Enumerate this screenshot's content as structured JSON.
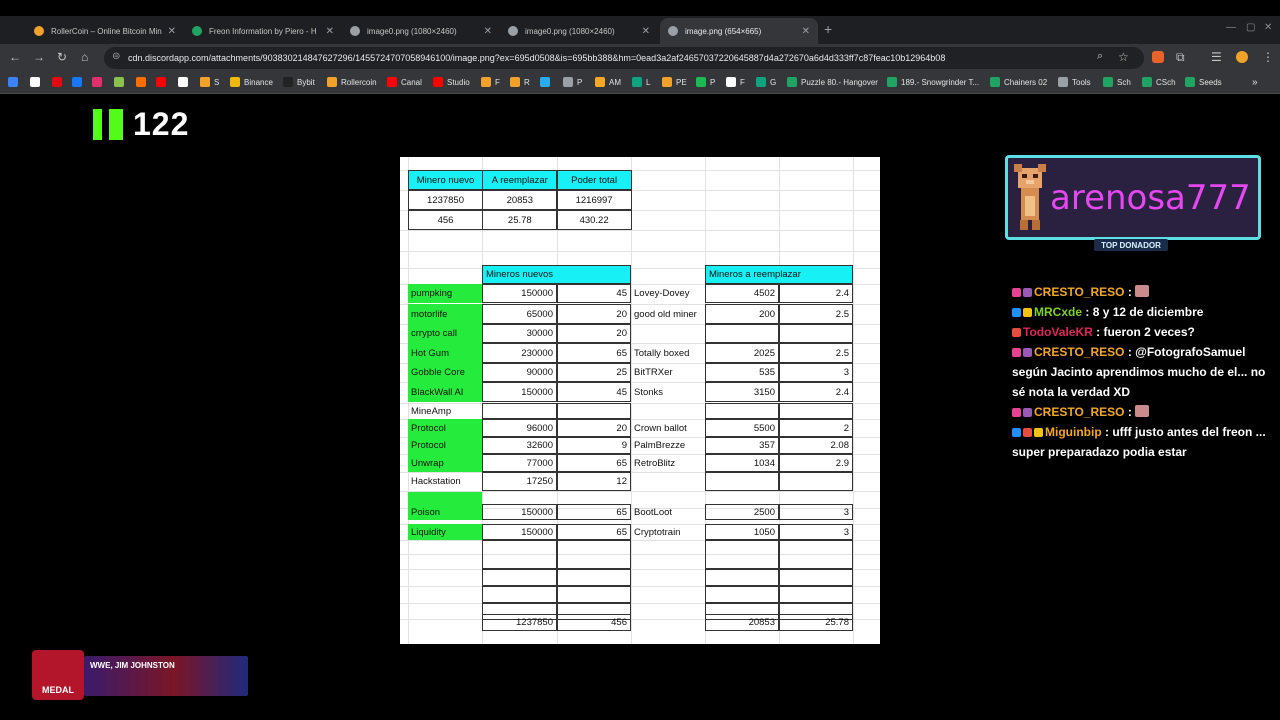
{
  "browser": {
    "tabs": [
      {
        "title": "RollerCoin – Online Bitcoin Min",
        "favicon": "rollercoin-icon",
        "color": "#f2a22a",
        "active": false
      },
      {
        "title": "Freon Information by Piero - H",
        "favicon": "sheets-icon",
        "color": "#1fa463",
        "active": false
      },
      {
        "title": "image0.png (1080×2460)",
        "favicon": "globe-icon",
        "color": "#9aa0a6",
        "active": false
      },
      {
        "title": "image0.png (1080×2460)",
        "favicon": "globe-icon",
        "color": "#9aa0a6",
        "active": false
      },
      {
        "title": "image.png (654×665)",
        "favicon": "globe-icon",
        "color": "#9aa0a6",
        "active": true
      }
    ],
    "url": "cdn.discordapp.com/attachments/903830214847627296/1455724707058946100/image.png?ex=695d0508&is=695bb388&hm=0ead3a2af24657037220645887d4a272670a6d4d333ff7c87feac10b12964b08",
    "bookmarks": [
      {
        "label": "",
        "color": "#3b82f6"
      },
      {
        "label": "",
        "color": "#ffffff"
      },
      {
        "label": "",
        "color": "#e50914"
      },
      {
        "label": "",
        "color": "#1877f2"
      },
      {
        "label": "",
        "color": "#e1306c"
      },
      {
        "label": "",
        "color": "#8bc34a"
      },
      {
        "label": "",
        "color": "#ff6f00"
      },
      {
        "label": "",
        "color": "#ff0000"
      },
      {
        "label": "",
        "color": "#ffffff"
      },
      {
        "label": "",
        "color": "#ffcc00"
      },
      {
        "label": "S",
        "color": "#f2a22a"
      },
      {
        "label": "Binance",
        "color": "#f0b90b"
      },
      {
        "label": "Bybit",
        "color": "#222222"
      },
      {
        "label": "Rollercoin",
        "color": "#f2a22a"
      },
      {
        "label": "Canal",
        "color": "#ff0000"
      },
      {
        "label": "Studio",
        "color": "#ff0000"
      },
      {
        "label": "F",
        "color": "#f2a22a"
      },
      {
        "label": "R",
        "color": "#f2a22a"
      },
      {
        "label": "",
        "color": "#2aabee"
      },
      {
        "label": "P",
        "color": "#9aa0a6"
      },
      {
        "label": "AM",
        "color": "#f9a825"
      },
      {
        "label": "L",
        "color": "#10a37f"
      },
      {
        "label": "PE",
        "color": "#f2a22a"
      },
      {
        "label": "P",
        "color": "#1db954"
      },
      {
        "label": "F",
        "color": "#ffffff"
      },
      {
        "label": "G",
        "color": "#10a37f"
      },
      {
        "label": "Puzzle 80.- Hangover",
        "color": "#1fa463"
      },
      {
        "label": "189.- Snowgrinder T...",
        "color": "#1fa463"
      },
      {
        "label": "Chainers 02",
        "color": "#1fa463"
      },
      {
        "label": "Tools",
        "color": "#9aa0a6"
      },
      {
        "label": "Sch",
        "color": "#1fa463"
      },
      {
        "label": "CSch",
        "color": "#1fa463"
      },
      {
        "label": "Seeds",
        "color": "#1fa463"
      }
    ]
  },
  "kick": {
    "count": "122",
    "accent": "#53fc18"
  },
  "sheet": {
    "summary_headers": [
      "Minero nuevo",
      "A reemplazar",
      "Poder total"
    ],
    "summary_rows": [
      [
        "1237850",
        "20853",
        "1216997"
      ],
      [
        "456",
        "25.78",
        "430.22"
      ]
    ],
    "new_header": "Mineros nuevos",
    "replace_header": "Mineros a reemplazar",
    "rows": [
      {
        "new_name": "pumpking",
        "new_power": "150000",
        "new_bonus": "45",
        "rep_name": "Lovey-Dovey",
        "rep_power": "4502",
        "rep_bonus": "2.4"
      },
      {
        "new_name": "motorlife",
        "new_power": "65000",
        "new_bonus": "20",
        "rep_name": "good old miner",
        "rep_power": "200",
        "rep_bonus": "2.5"
      },
      {
        "new_name": "crrypto call",
        "new_power": "30000",
        "new_bonus": "20",
        "rep_name": "",
        "rep_power": "",
        "rep_bonus": ""
      },
      {
        "new_name": "Hot Gum",
        "new_power": "230000",
        "new_bonus": "65",
        "rep_name": "Totally boxed",
        "rep_power": "2025",
        "rep_bonus": "2.5"
      },
      {
        "new_name": "Gobble Core",
        "new_power": "90000",
        "new_bonus": "25",
        "rep_name": "BitTRXer",
        "rep_power": "535",
        "rep_bonus": "3"
      },
      {
        "new_name": "BlackWall AI",
        "new_power": "150000",
        "new_bonus": "45",
        "rep_name": "Stonks",
        "rep_power": "3150",
        "rep_bonus": "2.4"
      },
      {
        "new_name": "MineAmp",
        "new_power": "",
        "new_bonus": "",
        "rep_name": "",
        "rep_power": "",
        "rep_bonus": ""
      },
      {
        "new_name": "Protocol",
        "new_power": "96000",
        "new_bonus": "20",
        "rep_name": "Crown ballot",
        "rep_power": "5500",
        "rep_bonus": "2"
      },
      {
        "new_name": "Protocol",
        "new_power": "32600",
        "new_bonus": "9",
        "rep_name": "PalmBrezze",
        "rep_power": "357",
        "rep_bonus": "2.08"
      },
      {
        "new_name": "Unwrap",
        "new_power": "77000",
        "new_bonus": "65",
        "rep_name": "RetroBlitz",
        "rep_power": "1034",
        "rep_bonus": "2.9"
      },
      {
        "new_name": "Hackstation",
        "new_power": "17250",
        "new_bonus": "12",
        "rep_name": "",
        "rep_power": "",
        "rep_bonus": ""
      },
      {
        "new_name": "Poison",
        "new_power": "150000",
        "new_bonus": "65",
        "rep_name": "BootLoot",
        "rep_power": "2500",
        "rep_bonus": "3"
      },
      {
        "new_name": "Liquidity",
        "new_power": "150000",
        "new_bonus": "65",
        "rep_name": "Cryptotrain",
        "rep_power": "1050",
        "rep_bonus": "3"
      }
    ],
    "totals": {
      "new_power": "1237850",
      "new_bonus": "456",
      "rep_power": "20853",
      "rep_bonus": "25.78"
    }
  },
  "donor": {
    "name": "arenosa777",
    "label": "TOP DONADOR"
  },
  "chat": [
    {
      "user": "CRESTO_RESO",
      "text": ":",
      "color": "#f5a623"
    },
    {
      "user": "MRCxde",
      "text": ": 8 y 12 de diciembre",
      "color": "#7ed321"
    },
    {
      "user": "TodoValeKR",
      "text": ": fueron 2 veces?",
      "color": "#e0245e"
    },
    {
      "user": "CRESTO_RESO",
      "text": ": @FotografoSamuel según Jacinto aprendimos mucho de el... no sé nota la verdad XD",
      "color": "#f5a623"
    },
    {
      "user": "CRESTO_RESO",
      "text": ":",
      "color": "#f5a623"
    },
    {
      "user": "Miguinbip",
      "text": ": ufff justo antes del freon ... super preparadazo podia estar",
      "color": "#f5a623"
    }
  ],
  "medal": {
    "brand": "MEDAL",
    "caption": "WWE, JIM JOHNSTON"
  }
}
